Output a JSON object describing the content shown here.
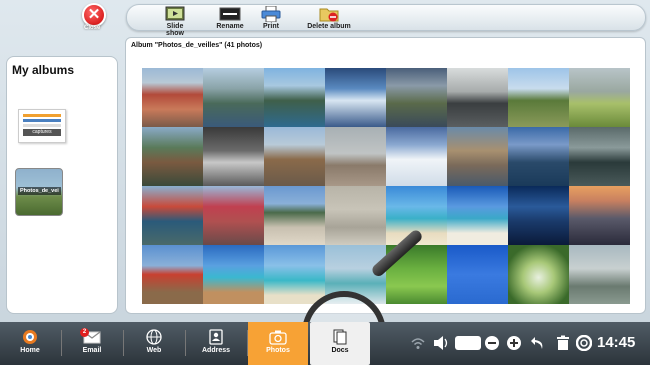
{
  "window": {
    "close_label": "Close"
  },
  "toolbar": {
    "slideshow_label": "Slide show",
    "rename_label": "Rename",
    "print_label": "Print",
    "delete_label": "Delete album"
  },
  "sidebar": {
    "title": "My albums",
    "albums": [
      {
        "label": "captures"
      },
      {
        "label": "Photos_de_vei"
      }
    ]
  },
  "main": {
    "heading": "Album \"Photos_de_veilles\" (41 photos)"
  },
  "taskbar": {
    "items": [
      {
        "label": "Home"
      },
      {
        "label": "Email",
        "badge": "2"
      },
      {
        "label": "Web"
      },
      {
        "label": "Address"
      },
      {
        "label": "Photos"
      },
      {
        "label": "Docs"
      }
    ],
    "clock": "14:45"
  },
  "colors": {
    "accent": "#f7a235",
    "close": "#cc0000",
    "taskbar": "#3a434a"
  }
}
